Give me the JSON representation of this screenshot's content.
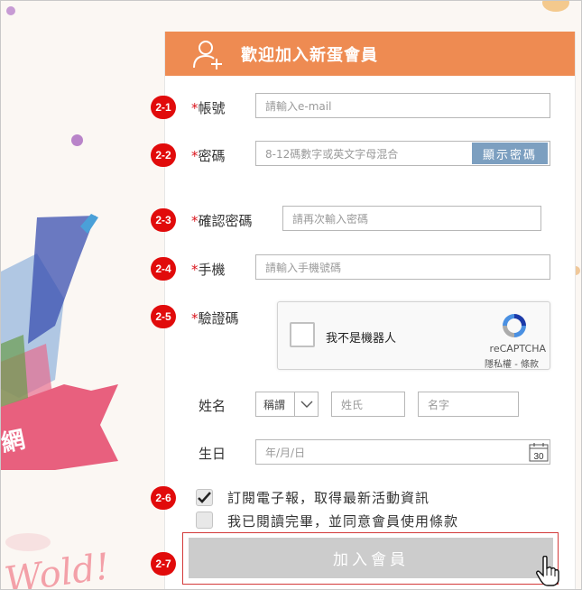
{
  "header": {
    "title": "歡迎加入新蛋會員",
    "icon": "add-user-icon",
    "color": "#ee8b52"
  },
  "background": {
    "ribbon_text": "網",
    "script_text": "Wold!"
  },
  "steps": [
    "2-1",
    "2-2",
    "2-3",
    "2-4",
    "2-5",
    "2-6",
    "2-7"
  ],
  "form": {
    "account": {
      "required": "*",
      "label": "帳號",
      "placeholder": "請輸入e-mail"
    },
    "password": {
      "required": "*",
      "label": "密碼",
      "placeholder": "8-12碼數字或英文字母混合",
      "show_button": "顯示密碼"
    },
    "confirm_password": {
      "required": "*",
      "label": "確認密碼",
      "placeholder": "請再次輸入密碼"
    },
    "phone": {
      "required": "*",
      "label": "手機",
      "placeholder": "請輸入手機號碼"
    },
    "captcha": {
      "required": "*",
      "label": "驗證碼",
      "checkbox_text": "我不是機器人",
      "brand": "reCAPTCHA",
      "links": "隱私權 - 條款"
    },
    "name": {
      "label": "姓名",
      "title_select": "稱謂",
      "last_placeholder": "姓氏",
      "first_placeholder": "名字"
    },
    "birthday": {
      "label": "生日",
      "placeholder": "年/月/日",
      "calendar_day": "30"
    }
  },
  "newsletter": {
    "label": "訂閱電子報，取得最新活動資訊",
    "checked": true
  },
  "terms": {
    "label": "我已閱讀完畢，並同意會員使用條款",
    "checked": false
  },
  "submit": {
    "label": "加入會員"
  },
  "colors": {
    "step_badge": "#e10b0b",
    "required": "#d9141c",
    "show_password": "#7c9fc0",
    "submit_disabled": "#cccccc"
  }
}
